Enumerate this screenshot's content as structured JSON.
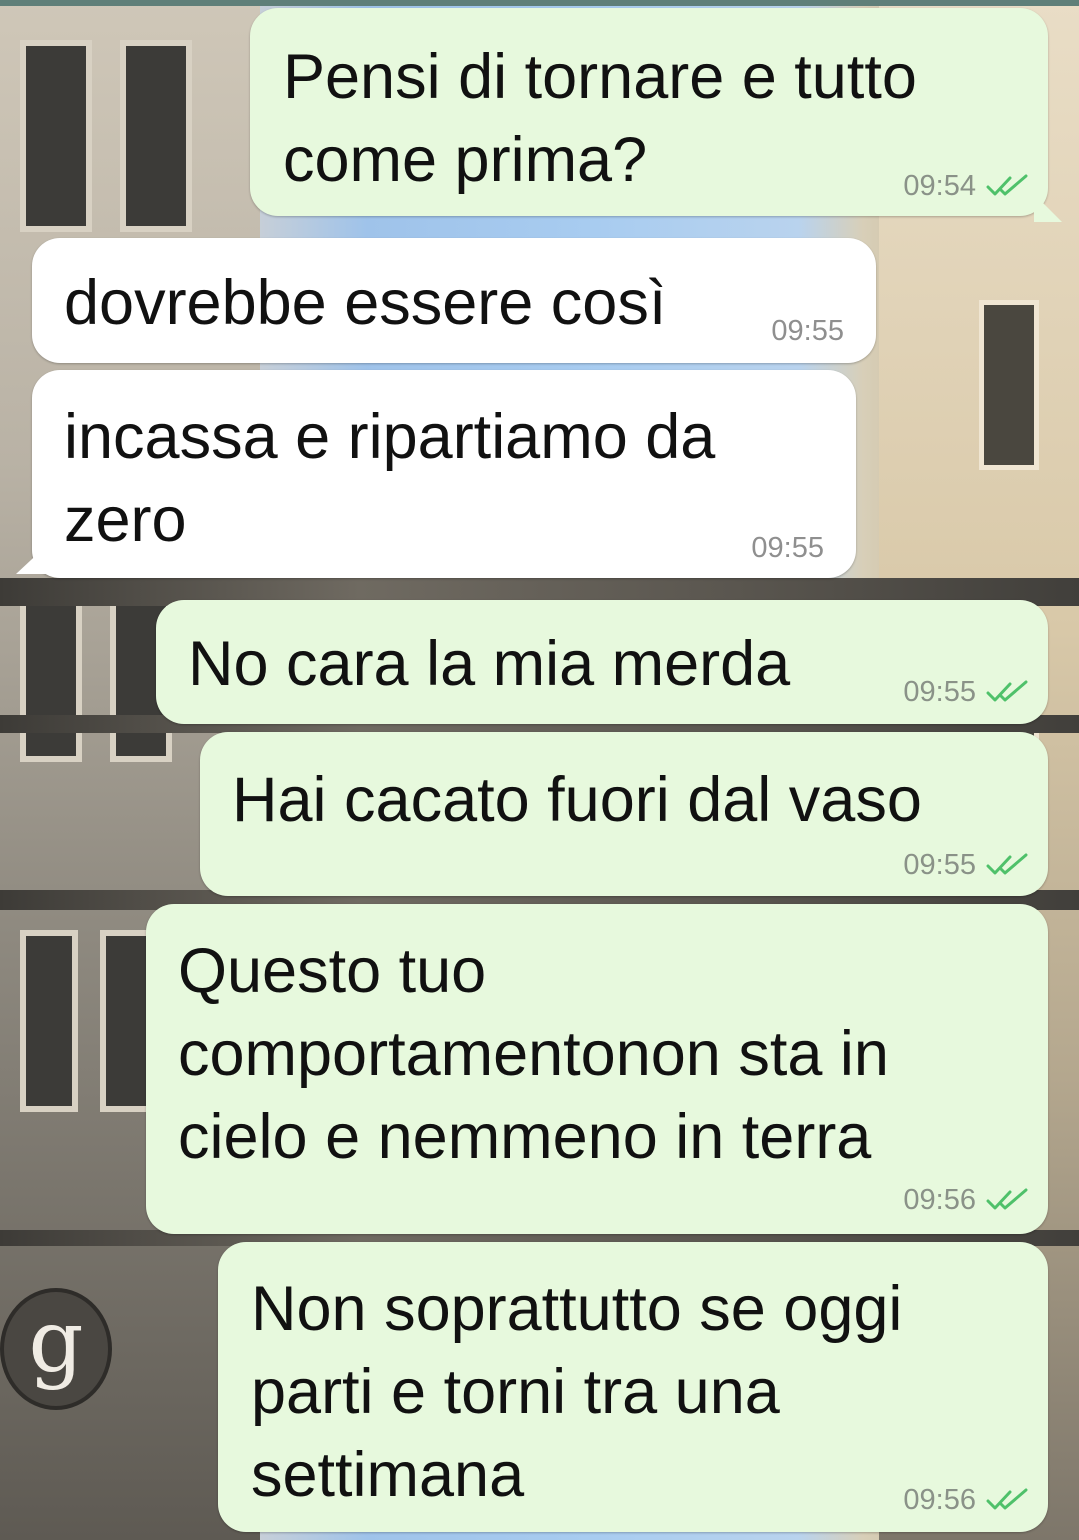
{
  "messages": [
    {
      "direction": "outgoing",
      "text_lines": [
        "Pensi di tornare e tutto",
        "come prima?"
      ],
      "time": "09:54",
      "status": "read"
    },
    {
      "direction": "incoming",
      "text_lines": [
        "dovrebbe essere così"
      ],
      "time": "09:55"
    },
    {
      "direction": "incoming",
      "text_lines": [
        "incassa e ripartiamo da",
        "zero"
      ],
      "time": "09:55"
    },
    {
      "direction": "outgoing",
      "text_lines": [
        "No cara la mia merda"
      ],
      "time": "09:55",
      "status": "read"
    },
    {
      "direction": "outgoing",
      "text_lines": [
        "Hai cacato fuori dal vaso"
      ],
      "time": "09:55",
      "status": "read"
    },
    {
      "direction": "outgoing",
      "text_lines": [
        "Questo tuo",
        "comportamentonon sta in",
        "cielo e nemmeno in terra"
      ],
      "time": "09:56",
      "status": "read"
    },
    {
      "direction": "outgoing",
      "text_lines": [
        "Non soprattutto se oggi",
        "parti e torni tra una",
        "settimana"
      ],
      "time": "09:56",
      "status": "read"
    }
  ],
  "wallpaper": {
    "sign_letter": "g"
  },
  "colors": {
    "outgoing_bubble": "#e7f9dd",
    "incoming_bubble": "#ffffff",
    "read_check": "#4fc16a",
    "timestamp": "#8a9288"
  },
  "icons": {
    "read_receipt": "double-check-icon"
  }
}
